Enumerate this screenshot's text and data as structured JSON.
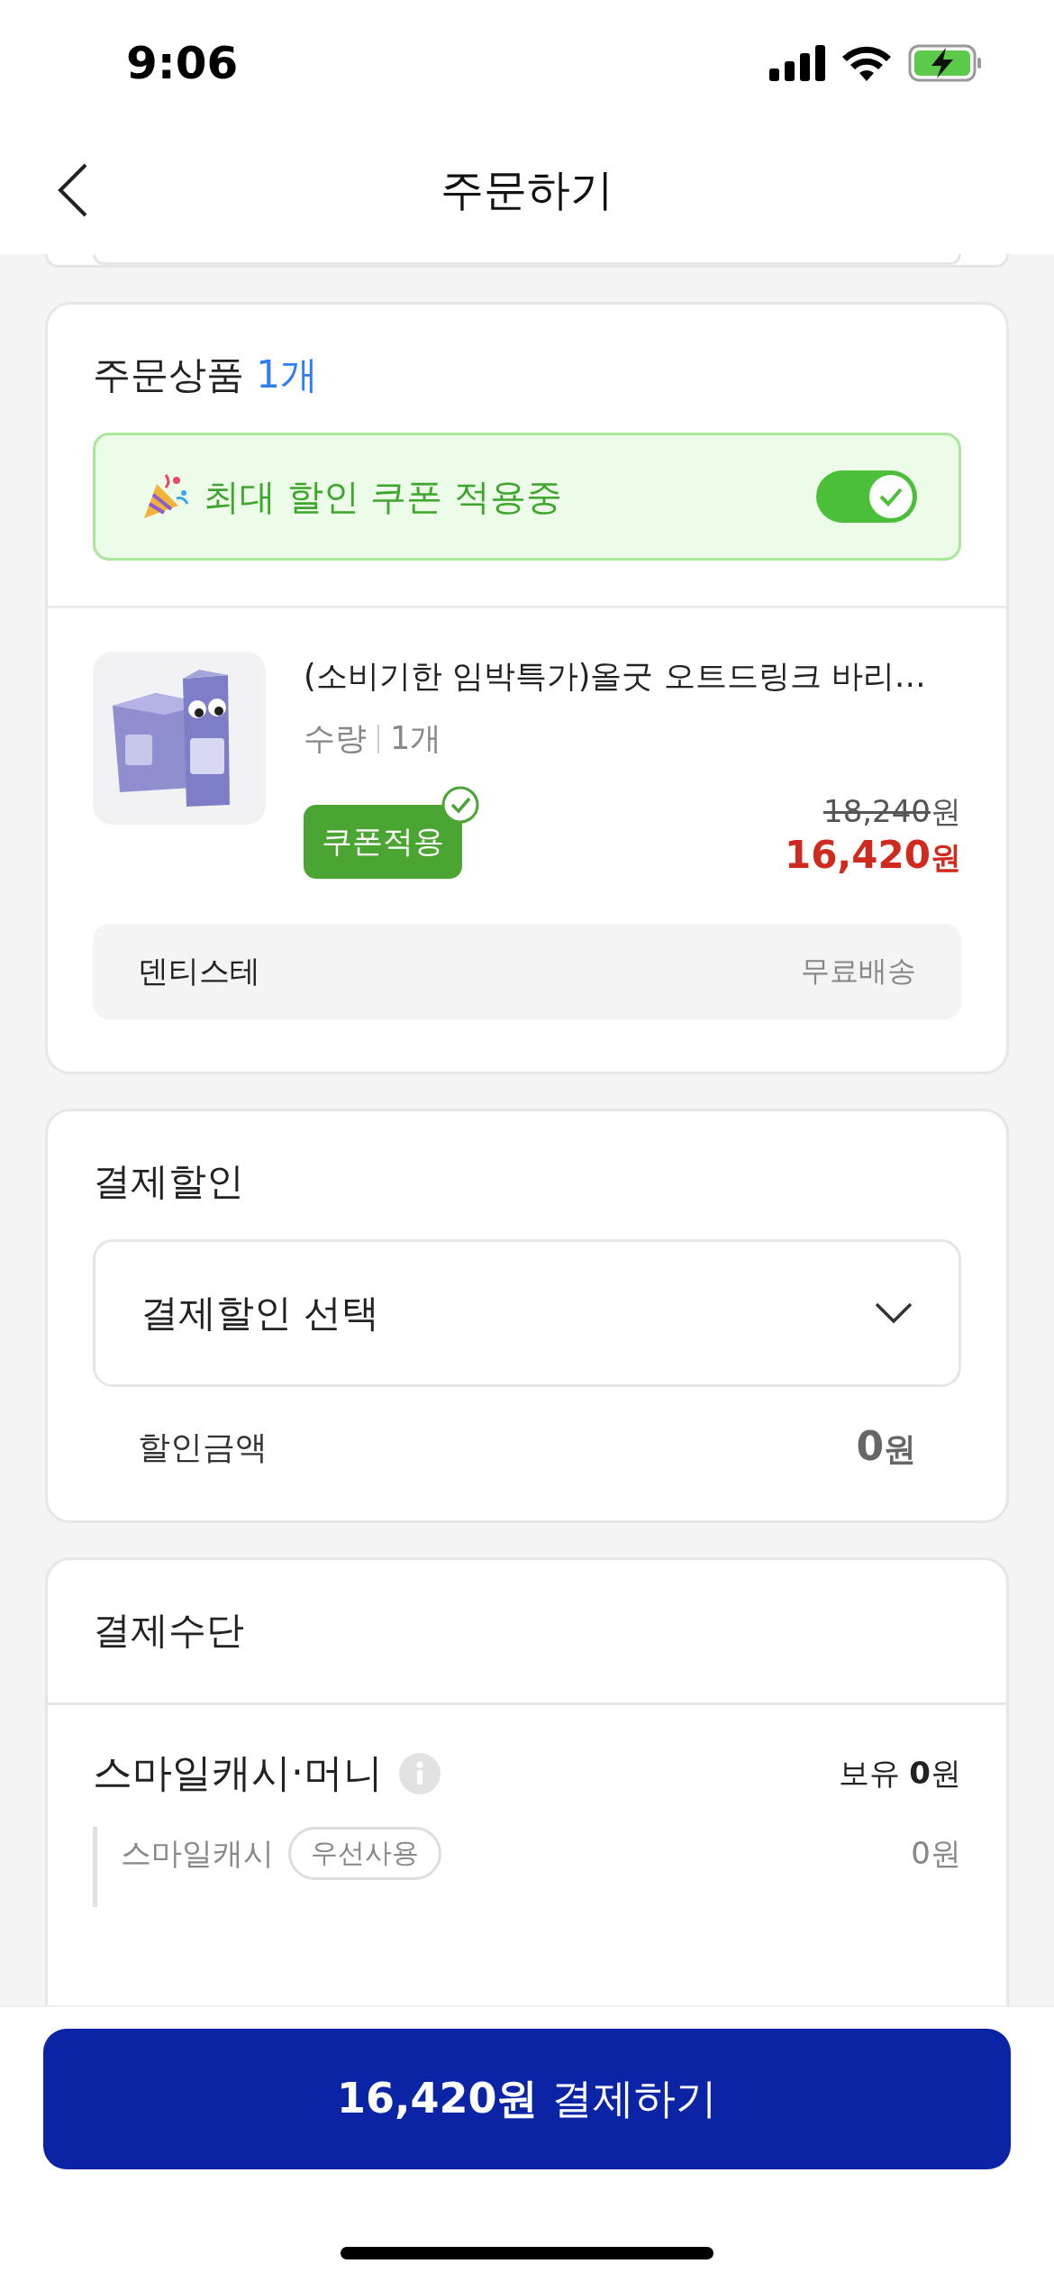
{
  "status_bar": {
    "time": "9:06"
  },
  "nav": {
    "title": "주문하기"
  },
  "order_items": {
    "heading": "주문상품",
    "count": "1개",
    "coupon_banner": {
      "label": "최대 할인 쿠폰 적용중",
      "on": true
    },
    "products": [
      {
        "title": "(소비기한 임박특가)올굿 오트드링크 바리…",
        "quantity_label": "수량",
        "quantity": "1개",
        "coupon_badge": "쿠폰적용",
        "coupon_applied": true,
        "original_price": "18,240",
        "original_unit": "원",
        "price": "16,420",
        "price_unit": "원"
      }
    ],
    "seller": {
      "name": "덴티스테",
      "shipping": "무료배송"
    }
  },
  "payment_discount": {
    "heading": "결제할인",
    "select": {
      "value": "결제할인 선택"
    },
    "amount_label": "할인금액",
    "amount": "0",
    "amount_unit": "원"
  },
  "payment_method": {
    "heading": "결제수단",
    "title": "스마일캐시·머니",
    "balance": "보유 **0**원",
    "sub_items": [
      {
        "label": "스마일캐시",
        "badge": "우선사용",
        "amount": "0원"
      }
    ]
  },
  "pay_button": {
    "label": "**16,420원** 결제하기"
  }
}
